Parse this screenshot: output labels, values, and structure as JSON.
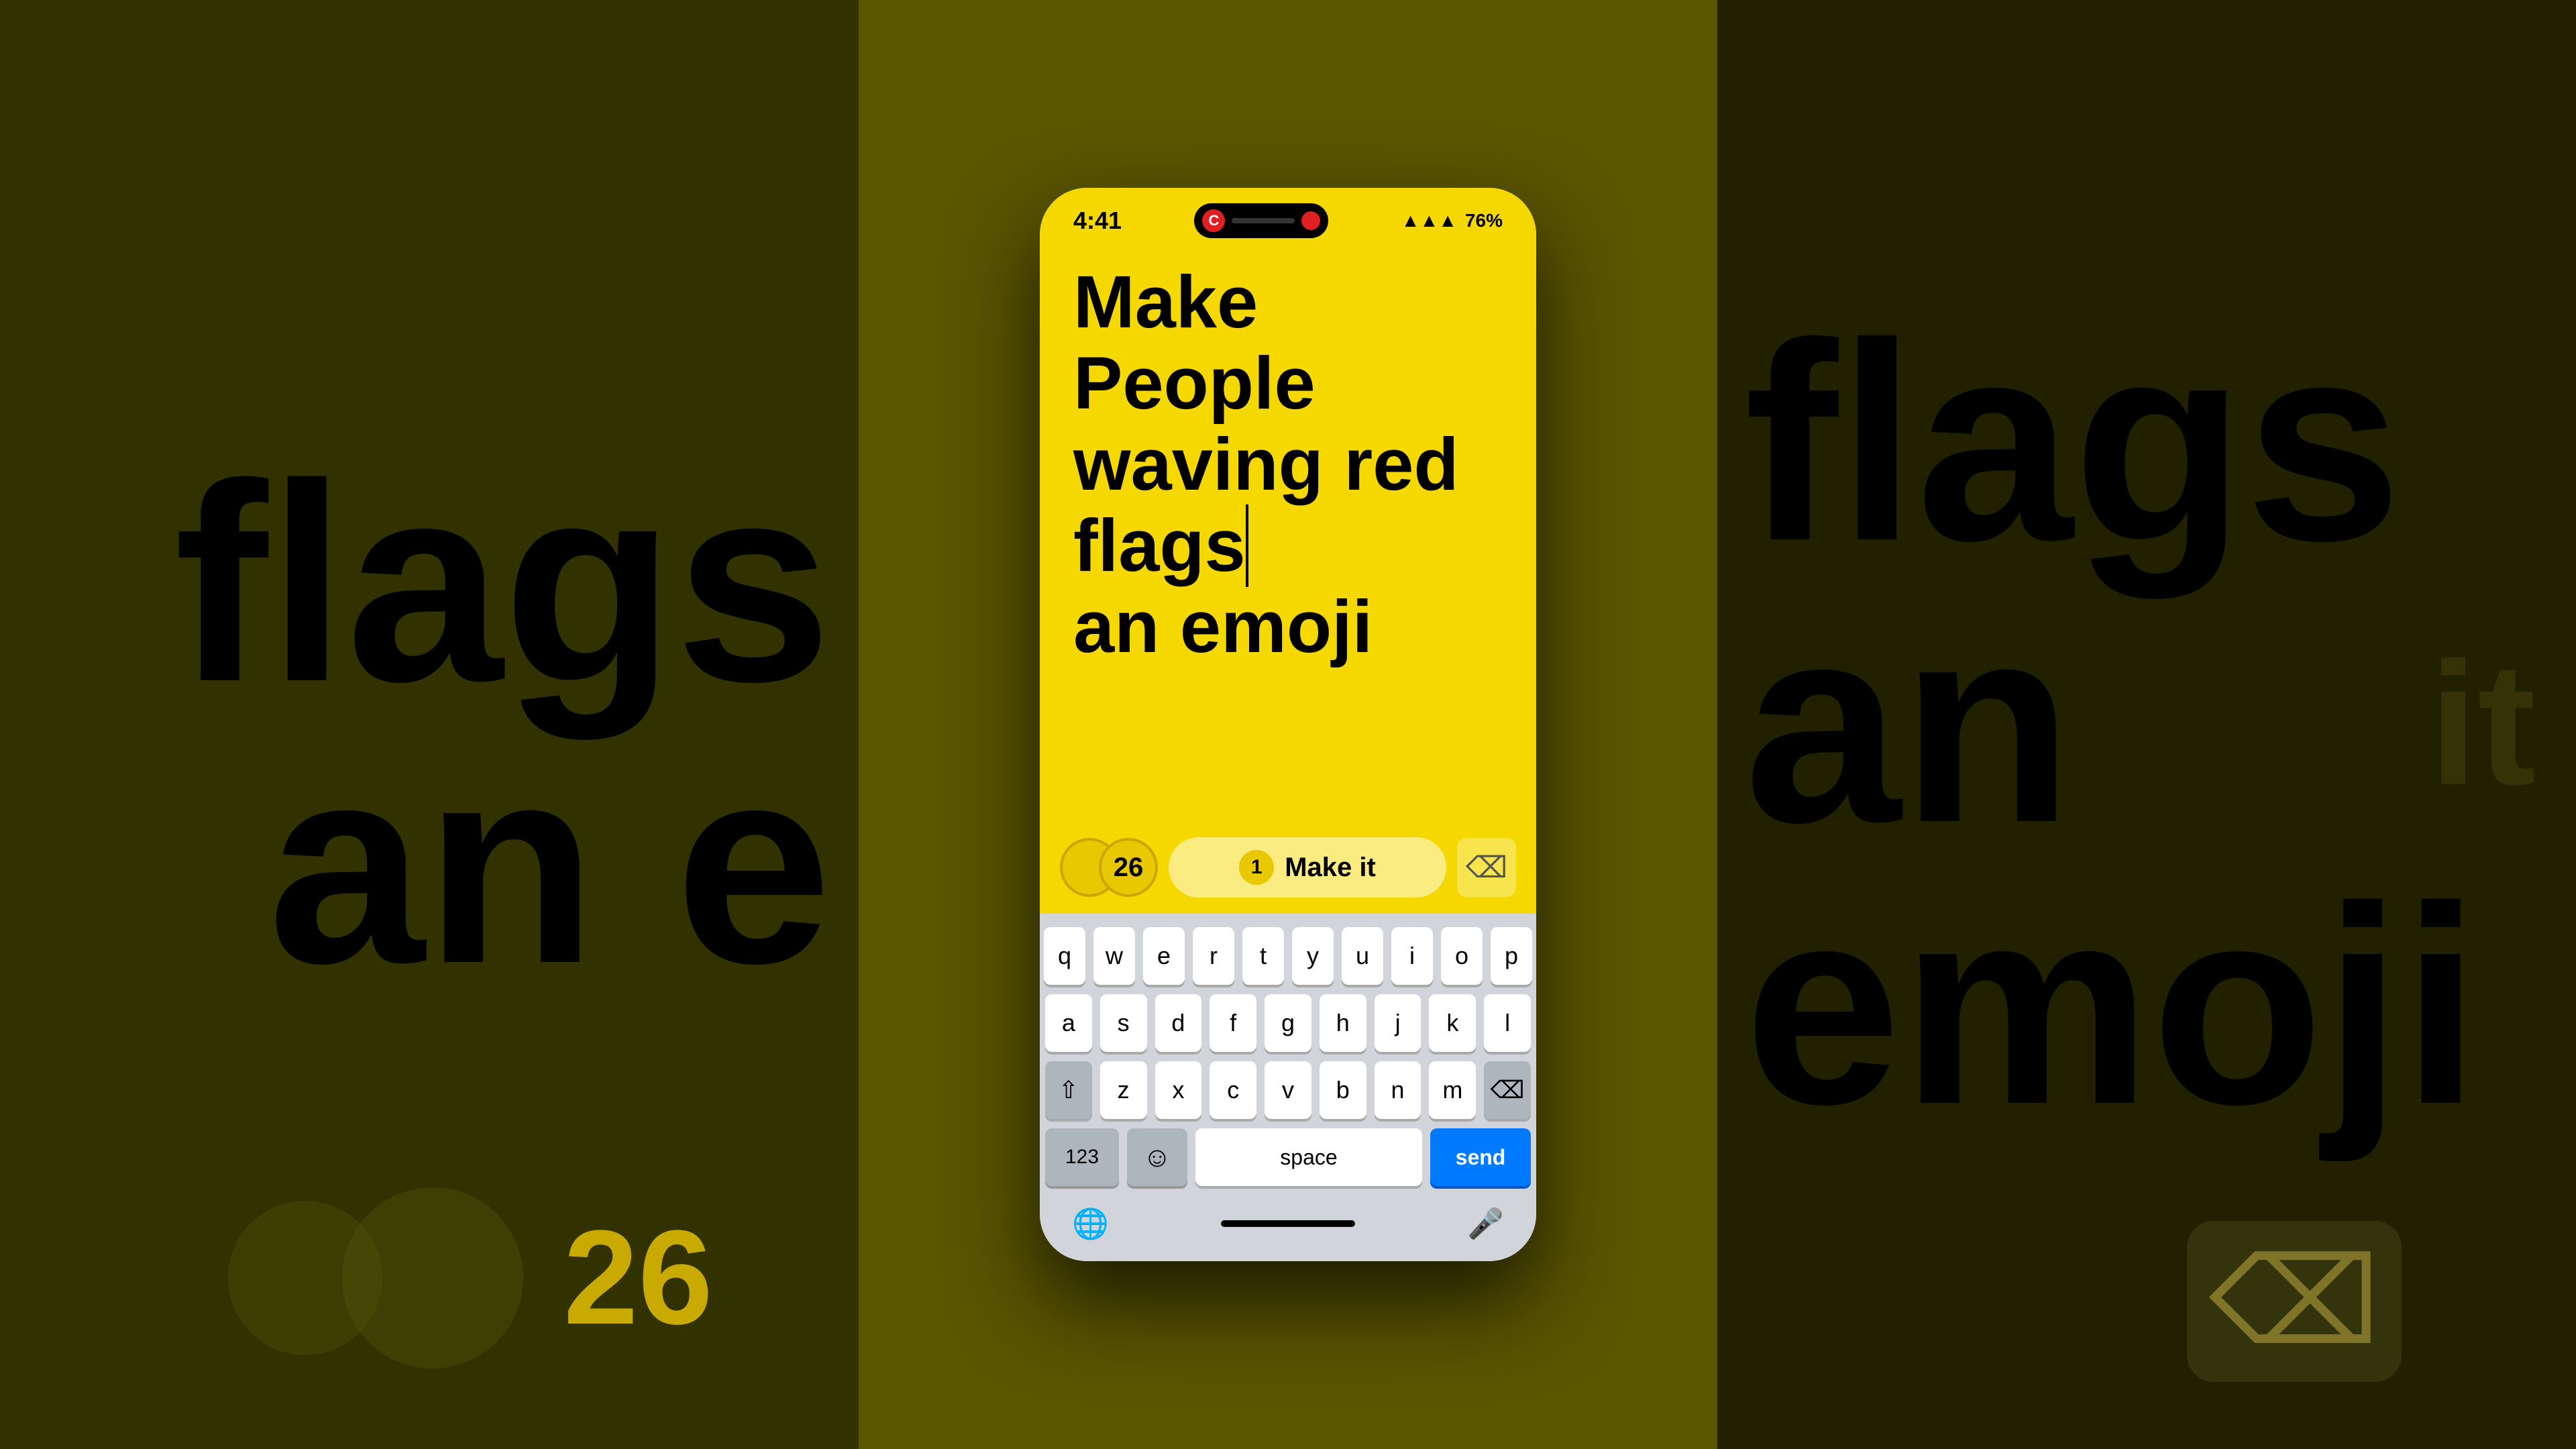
{
  "background": {
    "left_text_line1": "flags",
    "left_text_line2": "an e",
    "right_text_line1": "flags",
    "right_text_line2": "an emoji"
  },
  "status_bar": {
    "time": "4:41",
    "di_letter": "C",
    "battery": "76"
  },
  "main_text": {
    "line1": "Make",
    "line2": "People",
    "line3": "waving red",
    "line4": "flags",
    "line5": "an emoji"
  },
  "action_bar": {
    "coin_count": "26",
    "make_it_badge": "1",
    "make_it_label": "Make it"
  },
  "keyboard": {
    "row1": [
      "q",
      "w",
      "e",
      "r",
      "t",
      "y",
      "u",
      "i",
      "o",
      "p"
    ],
    "row2": [
      "a",
      "s",
      "d",
      "f",
      "g",
      "h",
      "j",
      "k",
      "l"
    ],
    "row3": [
      "z",
      "x",
      "c",
      "v",
      "b",
      "n",
      "m"
    ],
    "shift": "⇧",
    "backspace": "⌫",
    "key_123": "123",
    "emoji_key": "😊",
    "space_label": "space",
    "send_label": "send",
    "globe": "🌐",
    "mic": "🎤"
  }
}
